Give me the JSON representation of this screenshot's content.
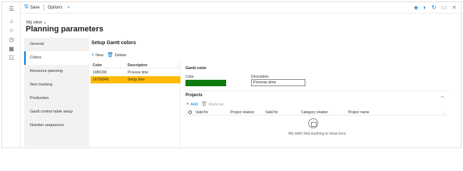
{
  "toolbar": {
    "save_label": "Save",
    "options_label": "Options"
  },
  "header": {
    "view_label": "My view",
    "page_title": "Planning parameters"
  },
  "settings_nav": {
    "items": [
      {
        "label": "General"
      },
      {
        "label": "Colors",
        "selected": true
      },
      {
        "label": "Resource planning"
      },
      {
        "label": "Item tracking"
      },
      {
        "label": "Production"
      },
      {
        "label": "Gantt control table setup"
      },
      {
        "label": "Number sequences"
      }
    ]
  },
  "gantt_colors": {
    "title": "Setup Gantt colors",
    "new_label": "New",
    "delete_label": "Delete",
    "columns": {
      "color": "Color",
      "description": "Description"
    },
    "rows": [
      {
        "color": "1080336",
        "description": "Process time",
        "selected": false
      },
      {
        "color": "16759040",
        "description": "Setup time",
        "selected": true
      }
    ]
  },
  "details": {
    "section_label": "Gantt color",
    "color_label": "Color",
    "swatch_color": "#0f7b0f",
    "description_label": "Description",
    "description_value": "Process time"
  },
  "projects": {
    "title": "Projects",
    "add_label": "Add",
    "remove_label": "Remove",
    "columns": {
      "valid_for": "Valid for",
      "project_relation": "Project relation",
      "valid_for_2": "Valid for",
      "category_relation": "Category relation",
      "project_name": "Project name"
    },
    "empty_message": "We didn't find anything to show here."
  },
  "colors": {
    "accent": "#0078d4",
    "selected_row": "#ffb900"
  }
}
